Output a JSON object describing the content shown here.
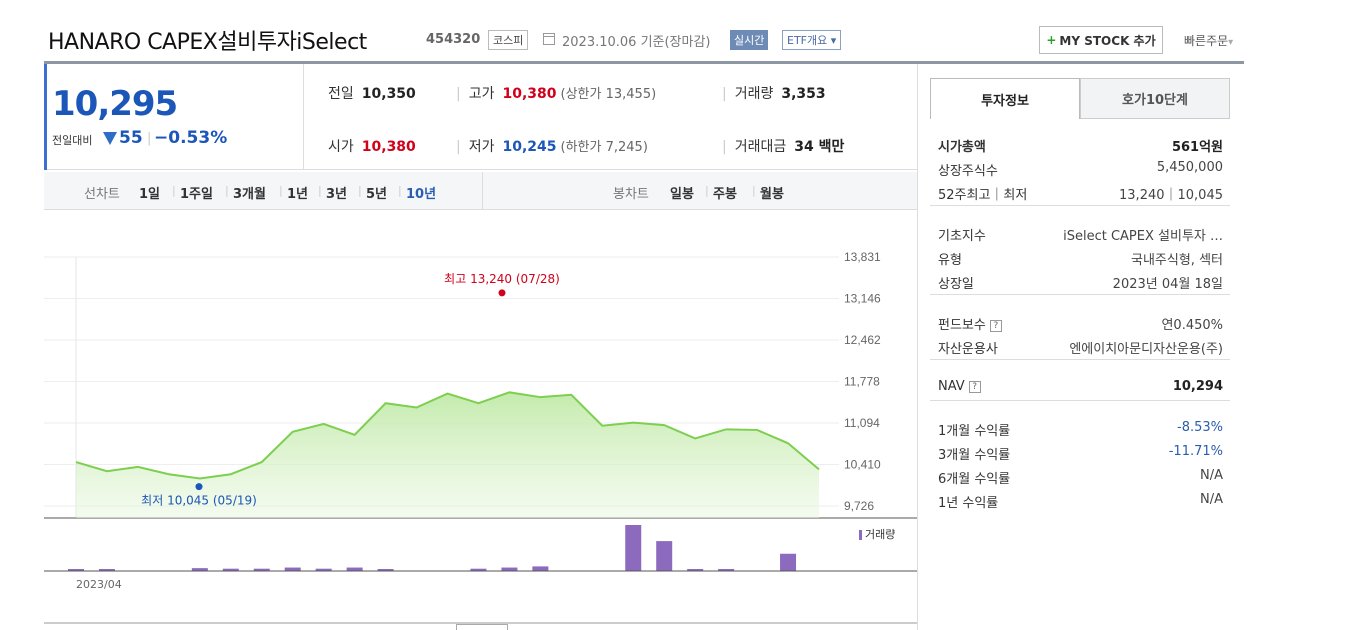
{
  "header": {
    "title": "HANARO CAPEX설비투자iSelect",
    "code": "454320",
    "market": "코스피",
    "base_date": "2023.10.06 기준(장마감)",
    "realtime_badge": "실시간",
    "etf_button": "ETF개요",
    "mystock_button": "MY STOCK 추가",
    "quick_order": "빠른주문"
  },
  "price": {
    "current": "10,295",
    "change_label": "전일대비",
    "change_amount": "55",
    "change_rate": "−0.53%"
  },
  "stats": {
    "prev_close_label": "전일",
    "prev_close": "10,350",
    "high_label": "고가",
    "high": "10,380",
    "upper_limit": "(상한가 13,455)",
    "volume_label": "거래량",
    "volume": "3,353",
    "open_label": "시가",
    "open": "10,380",
    "low_label": "저가",
    "low": "10,245",
    "lower_limit": "(하한가 7,245)",
    "value_label": "거래대금",
    "value": "34 백만"
  },
  "periods": {
    "line_label": "선차트",
    "line_items": [
      "1일",
      "1주일",
      "3개월",
      "1년",
      "3년",
      "5년",
      "10년"
    ],
    "active_line_item": "10년",
    "candle_label": "봉차트",
    "candle_items": [
      "일봉",
      "주봉",
      "월봉"
    ]
  },
  "chart_data": {
    "type": "area",
    "y_ticks": [
      "13,831",
      "13,146",
      "12,462",
      "11,778",
      "11,094",
      "10,410",
      "9,726"
    ],
    "ylim": [
      9726,
      13831
    ],
    "x_label": "2023/04",
    "high_annotation": "최고 13,240 (07/28)",
    "low_annotation": "최저 10,045 (05/19)",
    "values": [
      10450,
      10300,
      10370,
      10250,
      10180,
      10250,
      10450,
      10950,
      11080,
      10900,
      11420,
      11350,
      11580,
      11420,
      11600,
      11520,
      11560,
      11050,
      11100,
      11060,
      10840,
      10990,
      10980,
      10760,
      10330
    ],
    "volume_legend": "거래량",
    "volume": [
      3,
      3,
      0,
      0,
      5,
      4,
      4,
      6,
      4,
      6,
      3,
      0,
      0,
      4,
      6,
      8,
      0,
      0,
      80,
      52,
      3,
      3,
      0,
      30,
      0
    ]
  },
  "side": {
    "tab_active": "투자정보",
    "tab_inactive": "호가10단계",
    "rows": [
      {
        "label": "시가총액",
        "value": "561억원"
      },
      {
        "label": "상장주식수",
        "value": "5,450,000"
      },
      {
        "label": "52주최고｜최저",
        "value": "13,240｜10,045"
      },
      {
        "label": "기초지수",
        "value": "iSelect CAPEX 설비투자 …"
      },
      {
        "label": "유형",
        "value": "국내주식형, 섹터"
      },
      {
        "label": "상장일",
        "value": "2023년 04월 18일"
      },
      {
        "label": "펀드보수",
        "value": "연0.450%"
      },
      {
        "label": "자산운용사",
        "value": "엔에이치아문디자산운용(주)"
      },
      {
        "label": "NAV",
        "value": "10,294"
      },
      {
        "label": "1개월 수익률",
        "value": "-8.53%"
      },
      {
        "label": "3개월 수익률",
        "value": "-11.71%"
      },
      {
        "label": "6개월 수익률",
        "value": "N/A"
      },
      {
        "label": "1년 수익률",
        "value": "N/A"
      }
    ]
  },
  "colors": {
    "price_down": "#1b56b8",
    "price_up": "#d0021b",
    "line": "#7ccf4f",
    "volume_bar": "#8c6bbf"
  }
}
